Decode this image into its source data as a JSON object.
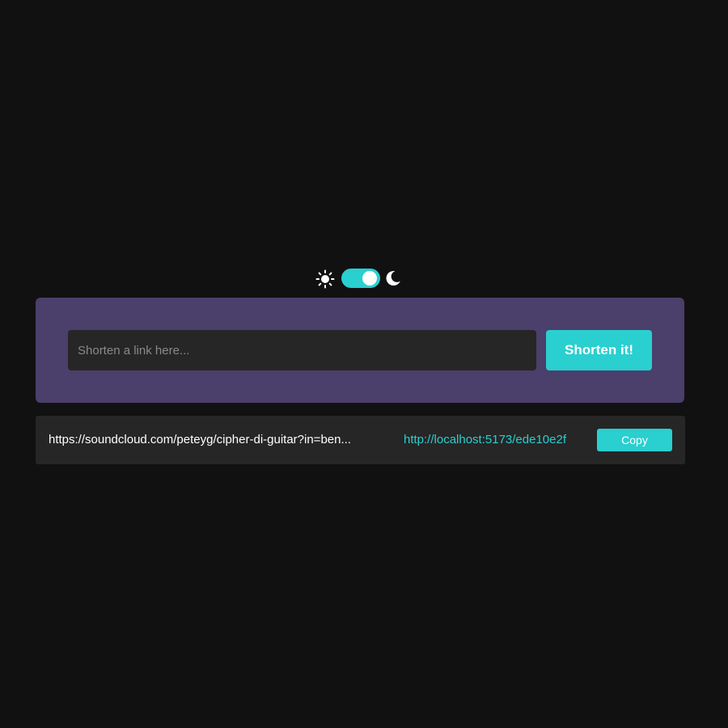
{
  "theme_toggle": {
    "left_icon": "sun-icon",
    "right_icon": "moon-icon",
    "state": "dark"
  },
  "shortener": {
    "input_placeholder": "Shorten a link here...",
    "input_value": "",
    "submit_label": "Shorten it!"
  },
  "results": [
    {
      "original": "https://soundcloud.com/peteyg/cipher-di-guitar?in=ben...",
      "short": "http://localhost:5173/ede10e2f",
      "copy_label": "Copy"
    }
  ],
  "colors": {
    "background": "#111111",
    "panel": "#4b3f6b",
    "accent": "#2acfcf",
    "input_bg": "#262626"
  }
}
